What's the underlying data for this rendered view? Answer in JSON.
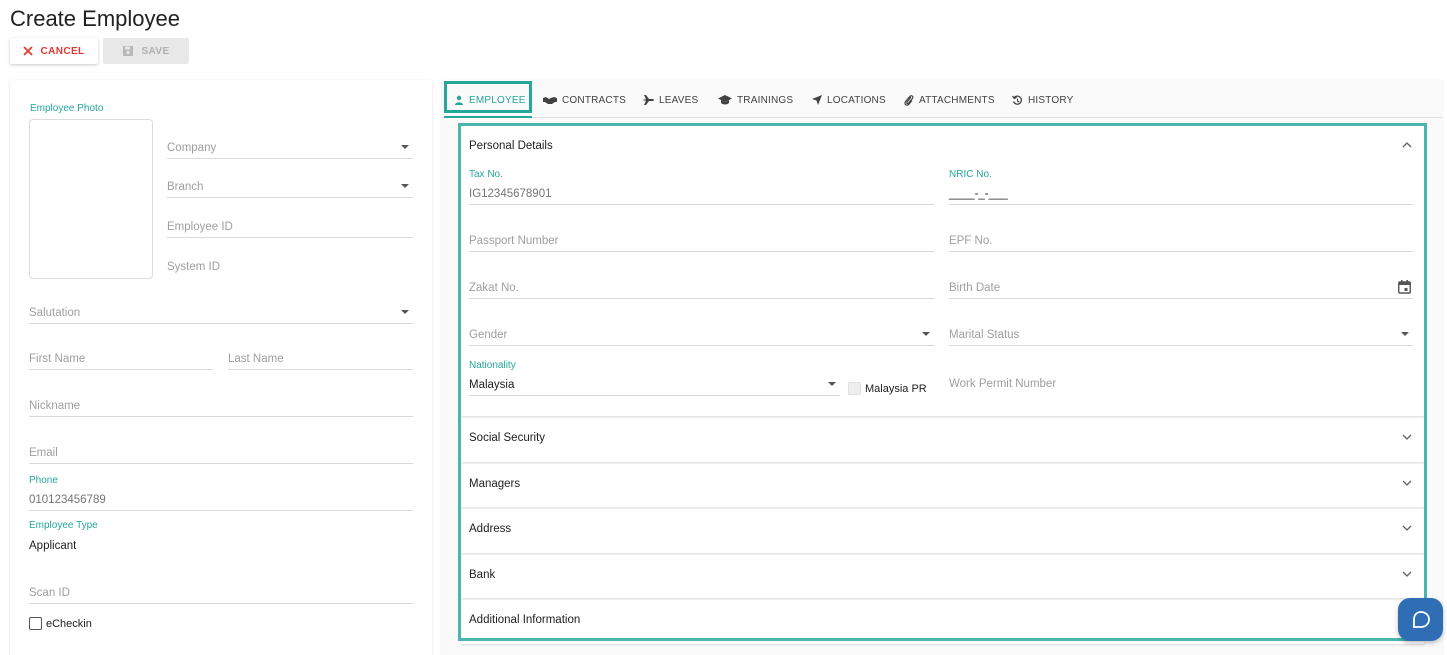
{
  "page": {
    "title": "Create Employee"
  },
  "toolbar": {
    "cancel_label": "CANCEL",
    "save_label": "SAVE"
  },
  "left": {
    "photo_label": "Employee Photo",
    "company_placeholder": "Company",
    "branch_placeholder": "Branch",
    "employee_id_placeholder": "Employee ID",
    "system_id_placeholder": "System ID",
    "salutation_placeholder": "Salutation",
    "first_name_placeholder": "First Name",
    "last_name_placeholder": "Last Name",
    "nickname_placeholder": "Nickname",
    "email_placeholder": "Email",
    "phone_label": "Phone",
    "phone_value": "010123456789",
    "employee_type_label": "Employee Type",
    "employee_type_value": "Applicant",
    "scan_id_placeholder": "Scan ID",
    "echeckin_label": "eCheckin"
  },
  "tabs": [
    {
      "label": "EMPLOYEE",
      "icon": "person-icon",
      "active": true
    },
    {
      "label": "CONTRACTS",
      "icon": "handshake-icon"
    },
    {
      "label": "LEAVES",
      "icon": "airplane-icon"
    },
    {
      "label": "TRAININGS",
      "icon": "graduation-cap-icon"
    },
    {
      "label": "LOCATIONS",
      "icon": "location-arrow-icon"
    },
    {
      "label": "ATTACHMENTS",
      "icon": "paperclip-icon"
    },
    {
      "label": "HISTORY",
      "icon": "history-icon"
    }
  ],
  "personal": {
    "title": "Personal Details",
    "tax_label": "Tax No.",
    "tax_value": "IG12345678901",
    "nric_label": "NRIC No.",
    "nric_value": "____-_-___",
    "passport_placeholder": "Passport Number",
    "epf_placeholder": "EPF No.",
    "zakat_placeholder": "Zakat No.",
    "birth_date_placeholder": "Birth Date",
    "gender_placeholder": "Gender",
    "marital_placeholder": "Marital Status",
    "nationality_label": "Nationality",
    "nationality_value": "Malaysia",
    "malaysia_pr_label": "Malaysia PR",
    "work_permit_placeholder": "Work Permit Number"
  },
  "sections": [
    {
      "title": "Social Security"
    },
    {
      "title": "Managers"
    },
    {
      "title": "Address"
    },
    {
      "title": "Bank"
    },
    {
      "title": "Additional Information"
    }
  ],
  "colors": {
    "accent": "#26a69a",
    "danger": "#e53935",
    "fab": "#2f6db5"
  }
}
